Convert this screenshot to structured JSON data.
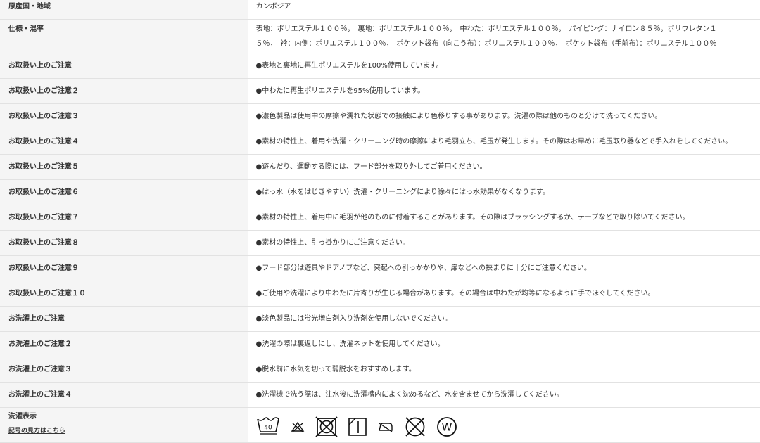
{
  "origin": {
    "label": "原産国・地域",
    "value": "カンボジア"
  },
  "spec": {
    "label": "仕様・混率",
    "line1": "表地：ポリエステル１００％，　裏地：ポリエステル１００％，　中わた：ポリエステル１００％，　パイピング：ナイロン８５％，ポリウレタン１",
    "line2": "５％，　衿：内側：ポリエステル１００％，　ポケット袋布（向こう布）：ポリエステル１００％，　ポケット袋布（手前布）：ポリエステル１００％"
  },
  "notes": [
    {
      "label": "お取扱い上のご注意",
      "value": "●表地と裏地に再生ポリエステルを100%使用しています。"
    },
    {
      "label": "お取扱い上のご注意２",
      "value": "●中わたに再生ポリエステルを95%使用しています。"
    },
    {
      "label": "お取扱い上のご注意３",
      "value": "●濃色製品は使用中の摩擦や濡れた状態での接触により色移りする事があります。洗濯の際は他のものと分けて洗ってください。"
    },
    {
      "label": "お取扱い上のご注意４",
      "value": "●素材の特性上、着用や洗濯・クリーニング時の摩擦により毛羽立ち、毛玉が発生します。その際はお早めに毛玉取り器などで手入れをしてください。"
    },
    {
      "label": "お取扱い上のご注意５",
      "value": "●遊んだり、運動する際には、フード部分を取り外してご着用ください。"
    },
    {
      "label": "お取扱い上のご注意６",
      "value": "●はっ水（水をはじきやすい）洗濯・クリーニングにより徐々にはっ水効果がなくなります。"
    },
    {
      "label": "お取扱い上のご注意７",
      "value": "●素材の特性上、着用中に毛羽が他のものに付着することがあります。その際はブラッシングするか、テープなどで取り除いてください。"
    },
    {
      "label": "お取扱い上のご注意８",
      "value": "●素材の特性上、引っ掛かりにご注意ください。"
    },
    {
      "label": "お取扱い上のご注意９",
      "value": "●フード部分は遊具やドアノブなど、突起への引っかかりや、扉などへの挟まりに十分にご注意ください。"
    },
    {
      "label": "お取扱い上のご注意１０",
      "value": "●ご使用や洗濯により中わたに片寄りが生じる場合があります。その場合は中わたが均等になるように手でほぐしてください。"
    },
    {
      "label": "お洗濯上のご注意",
      "value": "●淡色製品には蛍光増白剤入り洗剤を使用しないでください。"
    },
    {
      "label": "お洗濯上のご注意２",
      "value": "●洗濯の際は裏返しにし、洗濯ネットを使用してください。"
    },
    {
      "label": "お洗濯上のご注意３",
      "value": "●脱水前に水気を切って弱脱水をおすすめします。"
    },
    {
      "label": "お洗濯上のご注意４",
      "value": "●洗濯機で洗う際は、注水後に洗濯槽内によく沈めるなど、水を含ませてから洗濯してください。"
    }
  ],
  "wash": {
    "label": "洗濯表示",
    "link": "記号の見方はこちら",
    "temp": "40",
    "wet_clean": "W",
    "icons": [
      "wash-40-gentle-icon",
      "no-bleach-icon",
      "no-tumble-dry-icon",
      "line-dry-shade-icon",
      "low-iron-icon",
      "no-dry-clean-icon",
      "wet-clean-icon"
    ]
  }
}
